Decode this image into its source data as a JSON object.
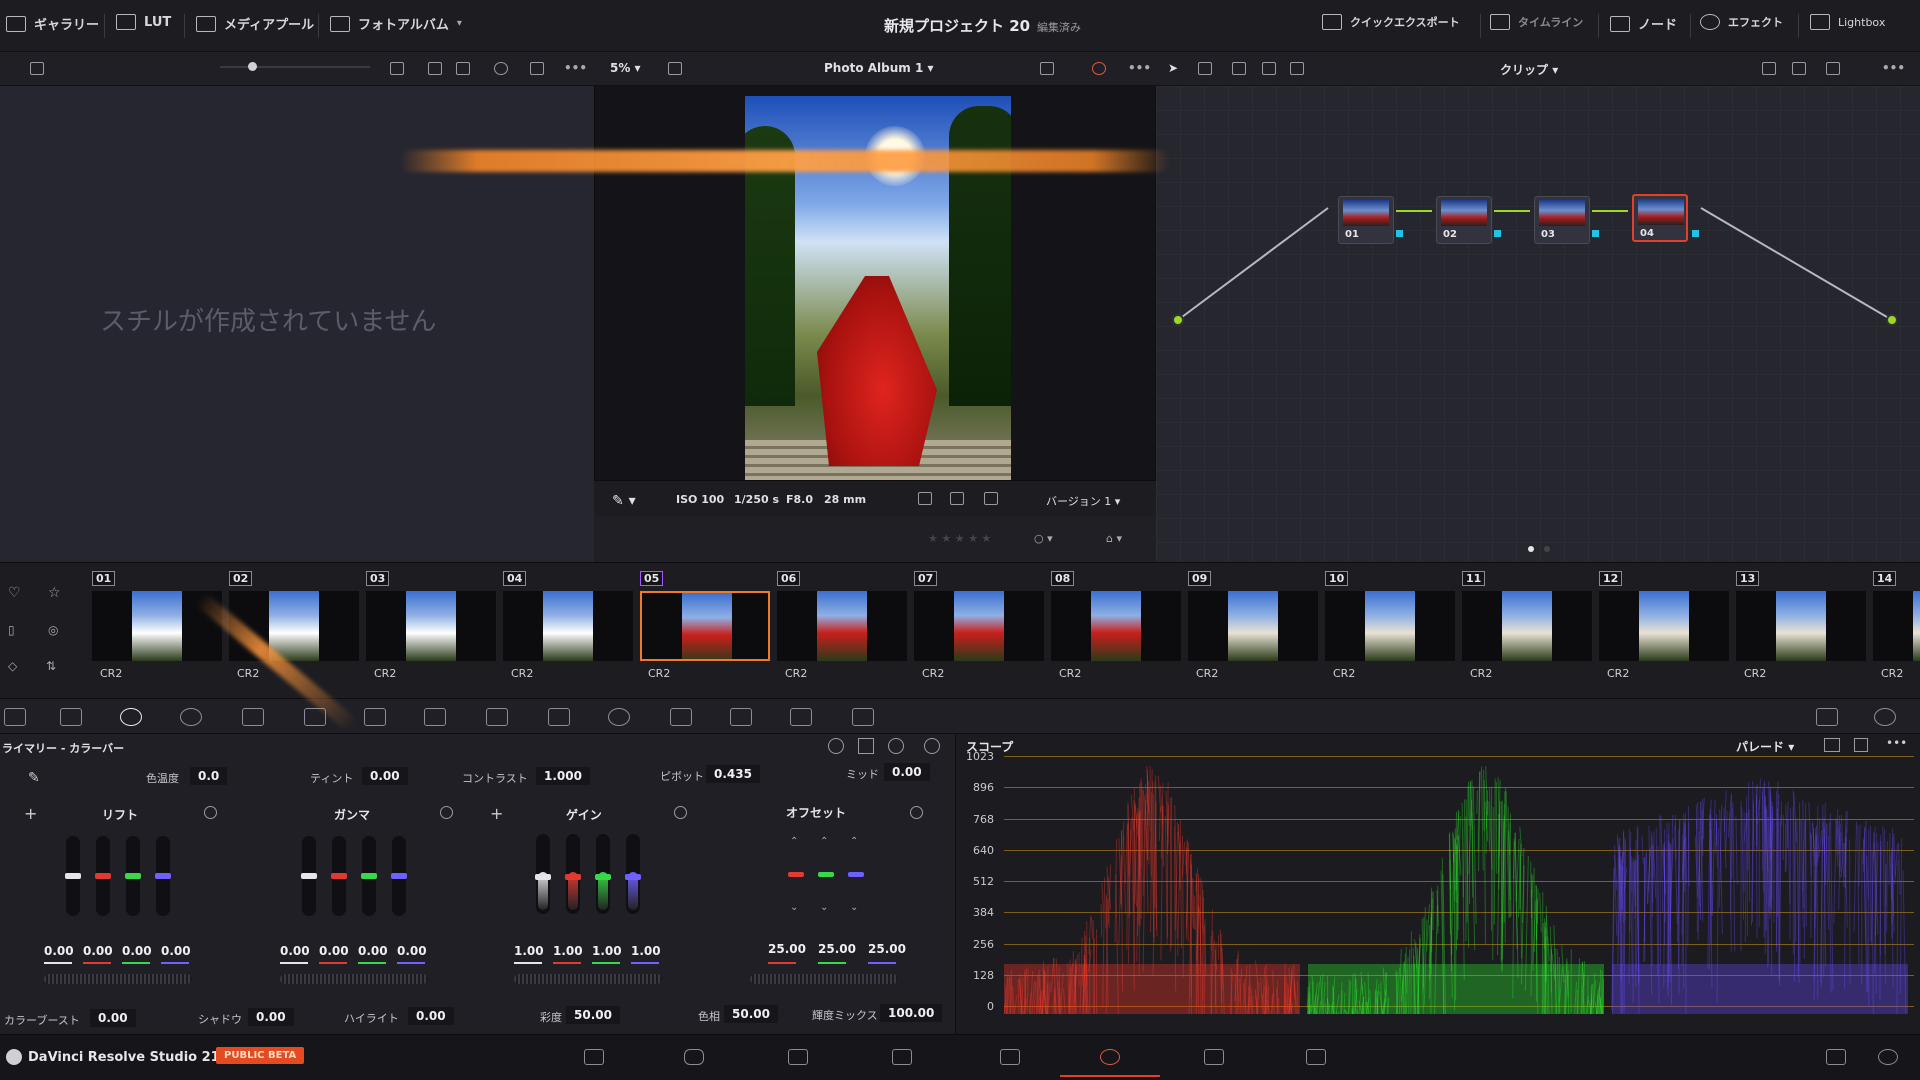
{
  "top": {
    "items": [
      {
        "label": "ギャラリー",
        "icon": "gallery-icon"
      },
      {
        "label": "LUT",
        "icon": "lut-icon"
      },
      {
        "label": "メディアプール",
        "icon": "media-pool-icon"
      },
      {
        "label": "フォトアルバム",
        "icon": "photo-album-icon"
      }
    ],
    "project_title": "新規プロジェクト 20",
    "project_status": "編集済み",
    "right_items": [
      {
        "label": "クイックエクスポート",
        "icon": "export-icon"
      },
      {
        "label": "タイムライン",
        "icon": "timeline-icon"
      },
      {
        "label": "ノード",
        "icon": "node-icon"
      },
      {
        "label": "エフェクト",
        "icon": "fx-icon"
      },
      {
        "label": "Lightbox",
        "icon": "lightbox-icon"
      }
    ]
  },
  "subbar": {
    "zoom": "5%",
    "album": "Photo Album 1",
    "clip_label": "クリップ"
  },
  "gallery": {
    "empty_text": "スチルが作成されていません"
  },
  "viewer": {
    "iso": "ISO 100",
    "shutter": "1/250 s",
    "aperture": "F8.0",
    "focal": "28 mm",
    "version": "バージョン 1",
    "stars": "★ ★ ★ ★ ★"
  },
  "nodes": [
    {
      "label": "01",
      "selected": false
    },
    {
      "label": "02",
      "selected": false
    },
    {
      "label": "03",
      "selected": false
    },
    {
      "label": "04",
      "selected": true
    }
  ],
  "clips": [
    {
      "num": "01",
      "ext": "CR2"
    },
    {
      "num": "02",
      "ext": "CR2"
    },
    {
      "num": "03",
      "ext": "CR2"
    },
    {
      "num": "04",
      "ext": "CR2"
    },
    {
      "num": "05",
      "ext": "CR2"
    },
    {
      "num": "06",
      "ext": "CR2"
    },
    {
      "num": "07",
      "ext": "CR2"
    },
    {
      "num": "08",
      "ext": "CR2"
    },
    {
      "num": "09",
      "ext": "CR2"
    },
    {
      "num": "10",
      "ext": "CR2"
    },
    {
      "num": "11",
      "ext": "CR2"
    },
    {
      "num": "12",
      "ext": "CR2"
    },
    {
      "num": "13",
      "ext": "CR2"
    },
    {
      "num": "14",
      "ext": "CR2"
    }
  ],
  "selected_clip": "05",
  "primary": {
    "title": "ライマリー - カラーバー",
    "temp_label": "色温度",
    "temp": "0.0",
    "tint_label": "ティント",
    "tint": "0.00",
    "contrast_label": "コントラスト",
    "contrast": "1.000",
    "pivot_label": "ピボット",
    "pivot": "0.435",
    "mid_label": "ミッド",
    "mid": "0.00",
    "wheels": [
      {
        "name": "リフト",
        "values": [
          "0.00",
          "0.00",
          "0.00",
          "0.00"
        ]
      },
      {
        "name": "ガンマ",
        "values": [
          "0.00",
          "0.00",
          "0.00",
          "0.00"
        ]
      },
      {
        "name": "ゲイン",
        "values": [
          "1.00",
          "1.00",
          "1.00",
          "1.00"
        ]
      },
      {
        "name": "オフセット",
        "values": [
          "25.00",
          "25.00",
          "25.00"
        ]
      }
    ],
    "boost_label": "カラーブースト",
    "boost": "0.00",
    "shadow_label": "シャドウ",
    "shadow": "0.00",
    "highlight_label": "ハイライト",
    "highlight": "0.00",
    "sat_label": "彩度",
    "sat": "50.00",
    "hue_label": "色相",
    "hue": "50.00",
    "lummix_label": "輝度ミックス",
    "lummix": "100.00"
  },
  "scope": {
    "title": "スコープ",
    "mode": "パレード",
    "y_ticks": [
      "1023",
      "896",
      "768",
      "640",
      "512",
      "384",
      "256",
      "128",
      "0"
    ],
    "colors": {
      "red": "#ff3a2a",
      "green": "#2cf02a",
      "blue": "#6a4cff"
    }
  },
  "bottom": {
    "app": "DaVinci Resolve Studio 21",
    "badge": "PUBLIC BETA"
  }
}
